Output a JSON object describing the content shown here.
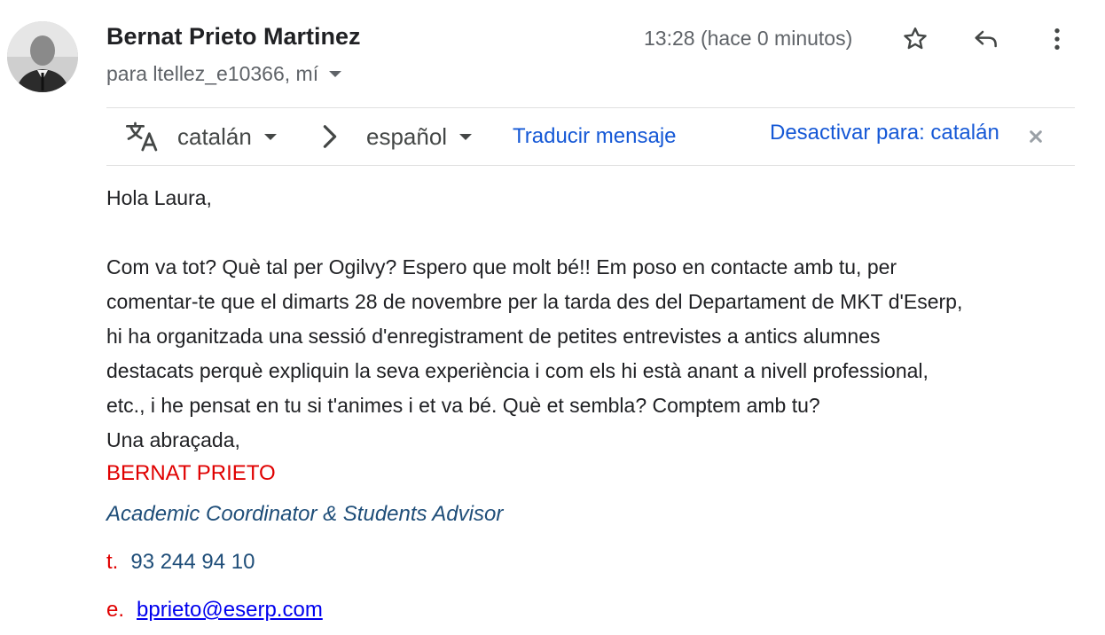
{
  "message": {
    "sender_name": "Bernat Prieto Martinez",
    "recipients": "para ltellez_e10366, mí",
    "timestamp": "13:28 (hace 0 minutos)",
    "icons": {
      "star": "star-icon",
      "reply": "reply-icon",
      "more": "more-vert-icon"
    }
  },
  "translate_bar": {
    "source_language": "catalán",
    "target_language": "español",
    "translate_label": "Traducir mensaje",
    "disable_label": "Desactivar para: catalán"
  },
  "body": {
    "greeting": "Hola Laura,",
    "paragraph_lines": [
      "Com va tot? Què tal per Ogilvy? Espero que molt bé!! Em poso en contacte amb tu, per",
      "comentar-te que el dimarts 28 de novembre per la tarda des del Departament de MKT d'Eserp,",
      "hi ha organitzada una sessió d'enregistrament de petites entrevistes a antics alumnes",
      "destacats perquè expliquin la seva experiència i com els hi està anant a nivell professional,",
      "etc., i he pensat en tu si t'animes i et va bé. Què et sembla? Comptem amb tu?"
    ],
    "closing": "Una abraçada,"
  },
  "signature": {
    "name": "BERNAT PRIETO",
    "title": "Academic Coordinator & Students Advisor",
    "phone_prefix": "t.",
    "phone": "93 244 94 10",
    "email_prefix": "e.",
    "email": "bprieto@eserp.com"
  },
  "colors": {
    "link_blue": "#1558d6",
    "signature_red": "#e00000",
    "signature_navy": "#1f4e79"
  }
}
